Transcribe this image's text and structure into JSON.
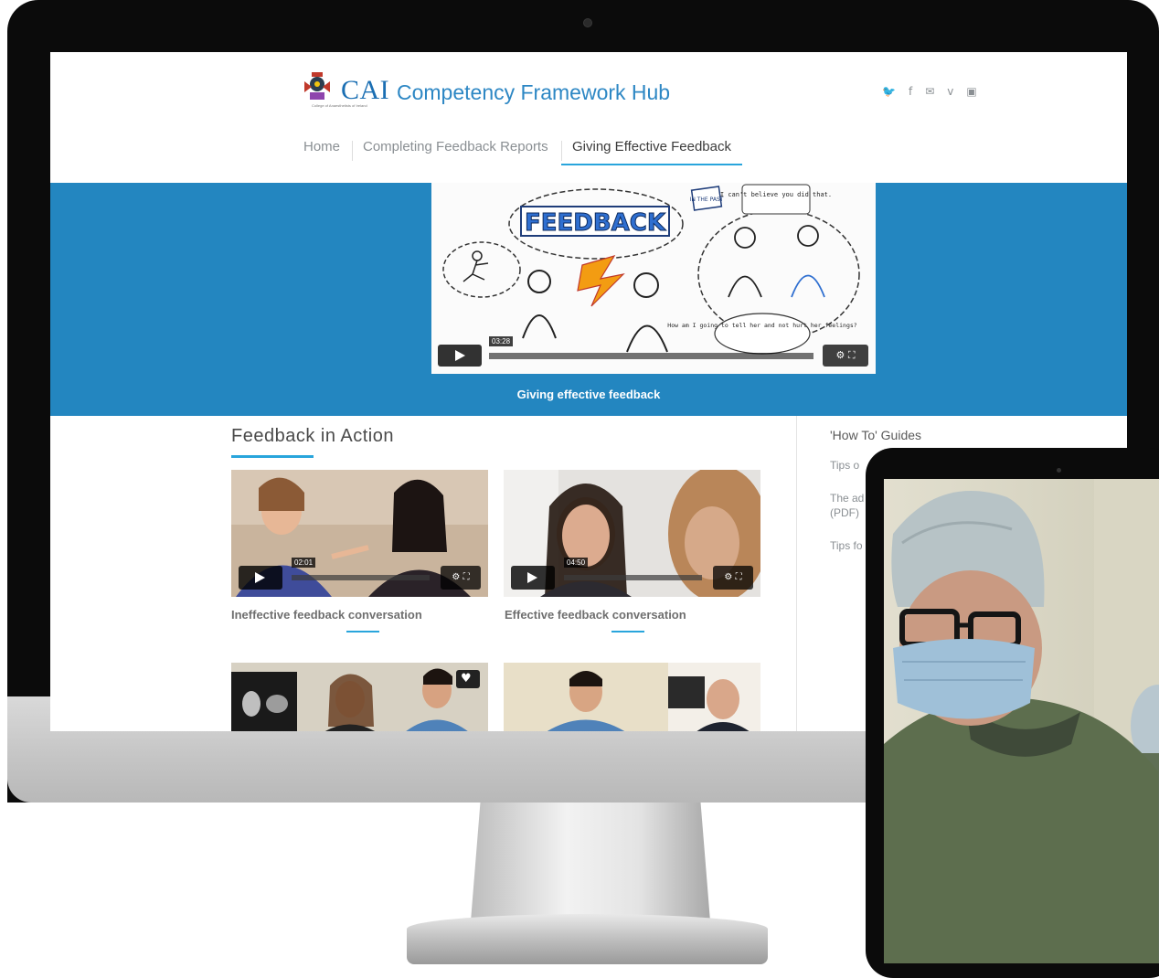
{
  "site": {
    "logo_cai": "CAI",
    "logo_rest": "Competency Framework Hub",
    "logo_subtitle": "College of Anaesthetists of Ireland"
  },
  "social": {
    "icons": [
      "twitter-icon",
      "facebook-icon",
      "email-icon",
      "vimeo-icon",
      "youtube-icon"
    ],
    "glyphs": [
      "🐦",
      "f",
      "✉",
      "v",
      "▣"
    ]
  },
  "nav": {
    "items": [
      {
        "label": "Home"
      },
      {
        "label": "Completing Feedback Reports"
      },
      {
        "label": "Giving Effective Feedback",
        "active": true
      }
    ]
  },
  "hero": {
    "caption": "Giving effective feedback",
    "video_time": "03:28",
    "illustration_text": {
      "title": "FEEDBACK",
      "bubble_past": "IN THE PAST",
      "bubble_quote": "I can't believe you did that.",
      "bubble_question": "How am I going to tell her and not hurt her feelings?"
    }
  },
  "main": {
    "section_title": "Feedback in Action",
    "videos": [
      {
        "caption": "Ineffective feedback conversation",
        "time": "02:01"
      },
      {
        "caption": "Effective feedback conversation",
        "time": "04:50"
      }
    ]
  },
  "sidebar": {
    "title": "'How To' Guides",
    "links": [
      "Tips o",
      "The ad (PDF)",
      "Tips fo"
    ]
  },
  "colors": {
    "accent": "#29a5dc",
    "hero_blue": "#2386c0",
    "brand_blue": "#1b6fb3"
  }
}
